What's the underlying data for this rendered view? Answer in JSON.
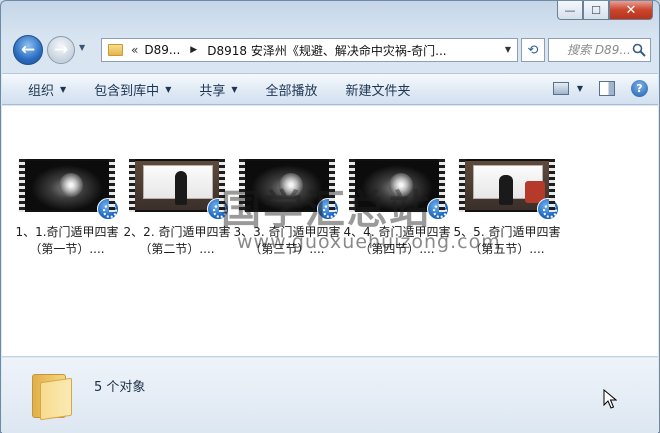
{
  "window": {
    "controls": {
      "minimize": "—",
      "maximize": "☐",
      "close": "✕"
    }
  },
  "nav": {
    "back_icon": "back-arrow-icon",
    "forward_icon": "forward-arrow-icon",
    "address": {
      "overflow": "«",
      "segment1": "D89...",
      "segment2": "D8918 安泽州《规避、解决命中灾祸-奇门..."
    },
    "search_placeholder": "搜索 D89..."
  },
  "toolbar": {
    "organize": "组织",
    "include_in_library": "包含到库中",
    "share": "共享",
    "play_all": "全部播放",
    "new_folder": "新建文件夹"
  },
  "files": [
    {
      "name": "1、1.奇门遁甲四害（第一节）....",
      "thumb": "dark"
    },
    {
      "name": "2、2. 奇门遁甲四害（第二节）....",
      "thumb": "room"
    },
    {
      "name": "3、3. 奇门遁甲四害（第三节）....",
      "thumb": "dark"
    },
    {
      "name": "4、4. 奇门遁甲四害（第四节）....",
      "thumb": "dark"
    },
    {
      "name": "5、5. 奇门遁甲四害（第五节）....",
      "thumb": "room"
    }
  ],
  "watermark": {
    "text": "国学汇总站",
    "url": "www.guoxuehuizong.com"
  },
  "details": {
    "count": "5 个对象"
  }
}
